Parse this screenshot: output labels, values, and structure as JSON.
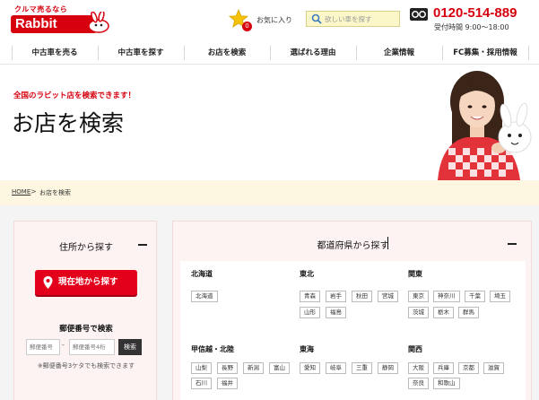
{
  "header": {
    "logo_tagline": "クルマ売るなら",
    "logo_text": "Rabbit",
    "favorites_label": "お気に入り",
    "favorites_count": "0",
    "search_placeholder": "欲しい車を探す",
    "phone_number": "0120-514-889",
    "hours": "受付時間 9:00〜18:00",
    "colors": {
      "brand_red": "#d7000f",
      "search_bg": "#fbf7c9"
    }
  },
  "nav": {
    "items": [
      {
        "label": "中古車を売る"
      },
      {
        "label": "中古車を探す"
      },
      {
        "label": "お店を検索"
      },
      {
        "label": "選ばれる理由"
      },
      {
        "label": "企業情報"
      },
      {
        "label": "FC募集・採用情報"
      }
    ]
  },
  "hero": {
    "subtitle": "全国のラビット店を検索できます！",
    "title": "お店を検索"
  },
  "breadcrumb": {
    "home": "HOME",
    "separator": ">",
    "current": "お店を検索"
  },
  "address_panel": {
    "title": "住所から探す",
    "location_button": "現在地から探す",
    "zip_title": "郵便番号で検索",
    "zip_placeholder_1": "郵便番号",
    "zip_dash": "-",
    "zip_placeholder_2": "郵便番号4桁",
    "zip_button": "検索",
    "zip_note": "※郵便番号3ケタでも検索できます"
  },
  "prefecture_panel": {
    "title": "都道府県から探す",
    "regions": [
      {
        "name": "北海道",
        "prefs": [
          "北海道"
        ]
      },
      {
        "name": "東北",
        "prefs": [
          "青森",
          "岩手",
          "秋田",
          "宮城",
          "山形",
          "福島"
        ]
      },
      {
        "name": "関東",
        "prefs": [
          "東京",
          "神奈川",
          "千葉",
          "埼玉",
          "茨城",
          "栃木",
          "群馬"
        ]
      },
      {
        "name": "甲信越・北陸",
        "prefs": [
          "山梨",
          "長野",
          "新潟",
          "富山",
          "石川",
          "福井"
        ]
      },
      {
        "name": "東海",
        "prefs": [
          "愛知",
          "岐阜",
          "三重",
          "静岡"
        ]
      },
      {
        "name": "関西",
        "prefs": [
          "大阪",
          "兵庫",
          "京都",
          "滋賀",
          "奈良",
          "和歌山"
        ]
      }
    ]
  }
}
